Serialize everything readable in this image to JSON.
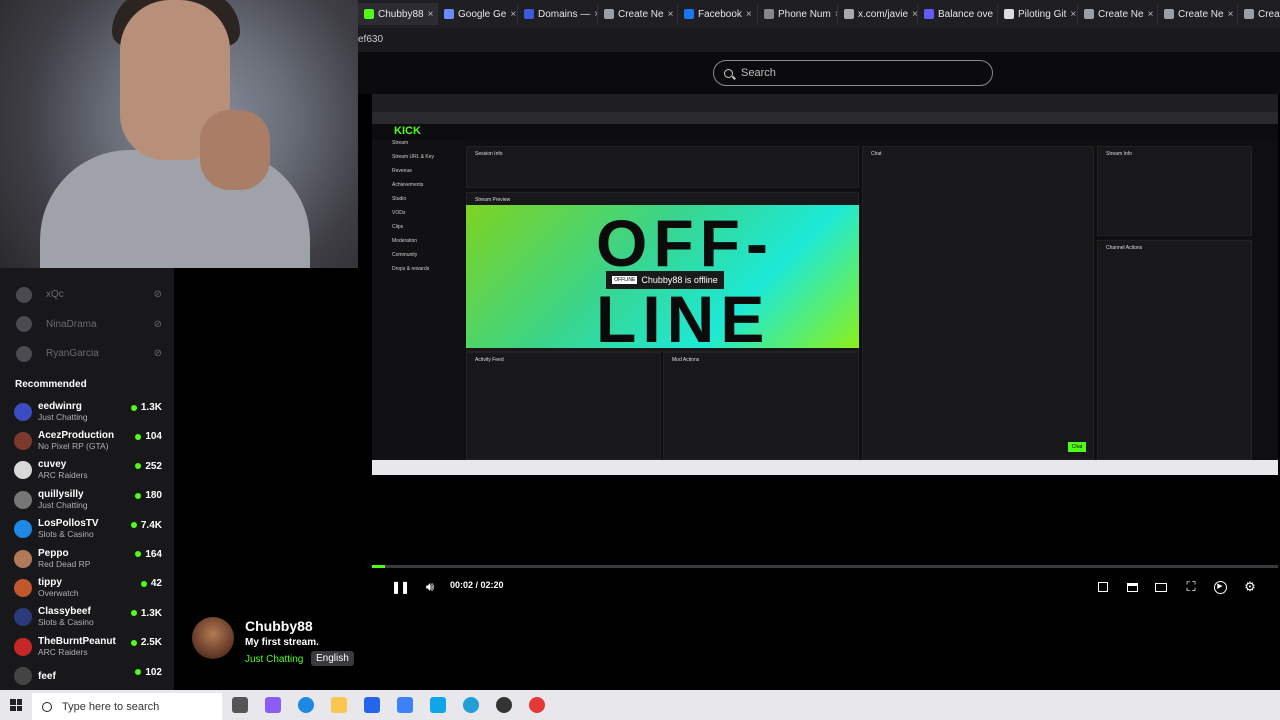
{
  "browser": {
    "tabs": [
      {
        "label": "Chubby88",
        "icon": "kick-icon",
        "color": "#53fc18",
        "active": true
      },
      {
        "label": "Google Ge",
        "icon": "gemini-icon",
        "color": "#6a8cff"
      },
      {
        "label": "Domains —",
        "icon": "domains-icon",
        "color": "#3b5bdb"
      },
      {
        "label": "Create Ne",
        "icon": "create-icon",
        "color": "#9aa0a6"
      },
      {
        "label": "Facebook",
        "icon": "facebook-icon",
        "color": "#1877f2"
      },
      {
        "label": "Phone Num",
        "icon": "phone-icon",
        "color": "#888"
      },
      {
        "label": "x.com/javie",
        "icon": "globe-icon",
        "color": "#aaa"
      },
      {
        "label": "Balance ove",
        "icon": "balance-icon",
        "color": "#635bff"
      },
      {
        "label": "Piloting Git",
        "icon": "github-icon",
        "color": "#ddd"
      },
      {
        "label": "Create Ne",
        "icon": "create-icon",
        "color": "#9aa0a6"
      },
      {
        "label": "Create Ne",
        "icon": "create-icon",
        "color": "#9aa0a6"
      },
      {
        "label": "Creat",
        "icon": "create-icon",
        "color": "#9aa0a6"
      }
    ],
    "tab_close": "×",
    "address_fragment": "ef630"
  },
  "search": {
    "placeholder": "Search"
  },
  "sidebar": {
    "followed": [
      {
        "name": "xQc"
      },
      {
        "name": "NinaDrama"
      },
      {
        "name": "RyanGarcia"
      }
    ],
    "recommended_title": "Recommended",
    "recommended": [
      {
        "name": "eedwinrg",
        "category": "Just Chatting",
        "viewers": "1.3K",
        "color": "#3b4cc0"
      },
      {
        "name": "AcezProduction",
        "category": "No Pixel RP (GTA)",
        "viewers": "104",
        "color": "#7a3b2e"
      },
      {
        "name": "cuvey",
        "category": "ARC Raiders",
        "viewers": "252",
        "color": "#d8d8d8"
      },
      {
        "name": "quillysilly",
        "category": "Just Chatting",
        "viewers": "180",
        "color": "#777"
      },
      {
        "name": "LosPollosTV",
        "category": "Slots & Casino",
        "viewers": "7.4K",
        "color": "#1e88e5"
      },
      {
        "name": "Peppo",
        "category": "Red Dead RP",
        "viewers": "164",
        "color": "#b07a5a"
      },
      {
        "name": "tippy",
        "category": "Overwatch",
        "viewers": "42",
        "color": "#c2572b"
      },
      {
        "name": "Classybeef",
        "category": "Slots & Casino",
        "viewers": "1.3K",
        "color": "#2a3a7a"
      },
      {
        "name": "TheBurntPeanut",
        "category": "ARC Raiders",
        "viewers": "2.5K",
        "color": "#c62828"
      },
      {
        "name": "feef",
        "category": "",
        "viewers": "102",
        "color": "#444"
      }
    ]
  },
  "player": {
    "time": "00:02 / 02:20",
    "progress": 0.014,
    "buffered": 0.2,
    "embedded": {
      "logo": "KICK",
      "nav": [
        "Stream",
        "Stream URL & Key",
        "Revenue",
        "Achievements",
        "Studio",
        "VODs",
        "Clips",
        "Moderation",
        "Community",
        "Drops & rewards"
      ],
      "session_info": "Session Info",
      "stream_preview": "Stream Preview",
      "offline_text": "OFF-LINE",
      "offline_badge": "OFFLINE",
      "offline_message": "Chubby88 is offline",
      "activity_feed": "Activity Feed",
      "mod_actions": "Mod Actions",
      "chat": "Chat",
      "stream_info": "Stream Info",
      "channel_actions": "Channel Actions",
      "chat_button": "Chat"
    }
  },
  "stream": {
    "name": "Chubby88",
    "title": "My first stream.",
    "category": "Just Chatting",
    "language": "English"
  },
  "taskbar": {
    "search_placeholder": "Type here to search"
  }
}
